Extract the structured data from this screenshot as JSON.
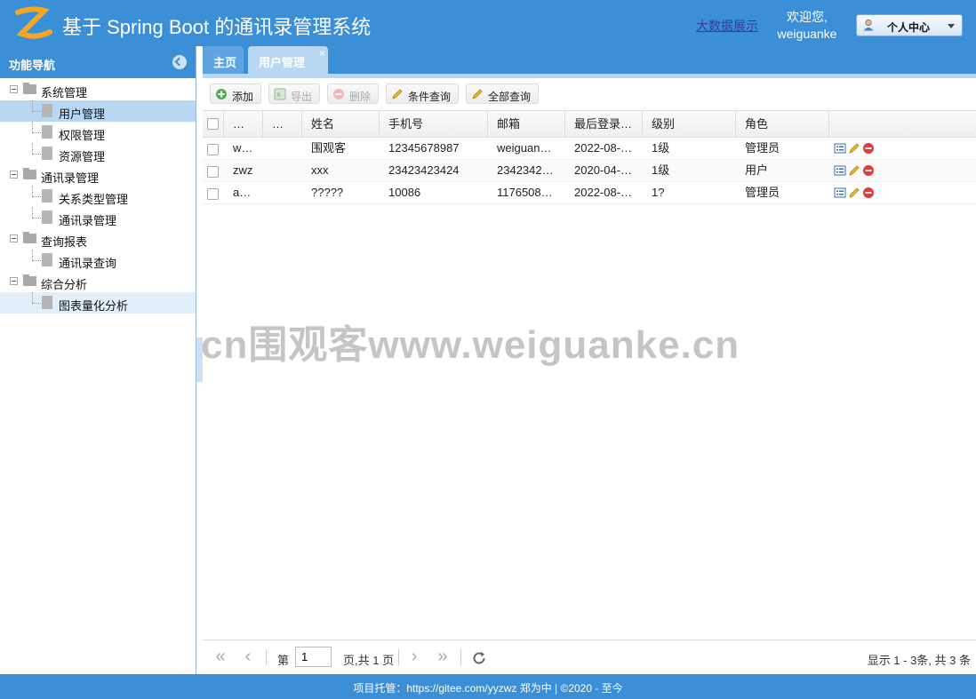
{
  "header": {
    "title": "基于 Spring Boot 的通讯录管理系统",
    "bigdata_link": "大数据展示",
    "welcome": "欢迎您,",
    "username": "weiguanke",
    "user_center": "个人中心"
  },
  "sidebar": {
    "title": "功能导航",
    "tree": [
      {
        "label": "系统管理",
        "children": [
          "用户管理",
          "权限管理",
          "资源管理"
        ]
      },
      {
        "label": "通讯录管理",
        "children": [
          "关系类型管理",
          "通讯录管理"
        ]
      },
      {
        "label": "查询报表",
        "children": [
          "通讯录查询"
        ]
      },
      {
        "label": "综合分析",
        "children": [
          "图表量化分析"
        ]
      }
    ]
  },
  "tabs": [
    {
      "label": "主页"
    },
    {
      "label": "用户管理",
      "close": "×"
    }
  ],
  "toolbar": {
    "add": "添加",
    "export": "导出",
    "delete": "删除",
    "cond_query": "条件查询",
    "all_query": "全部查询"
  },
  "grid": {
    "columns": [
      "…",
      "…",
      "姓名",
      "手机号",
      "邮箱",
      "最后登录…",
      "级别",
      "角色"
    ],
    "rows": [
      [
        "w…",
        "",
        "围观客",
        "12345678987",
        "weiguan…",
        "2022-08-…",
        "1级",
        "管理员"
      ],
      [
        "zwz",
        "",
        "xxx",
        "23423423424",
        "2342342…",
        "2020-04-…",
        "1级",
        "用户"
      ],
      [
        "a…",
        "",
        "?????",
        "10086",
        "1176508…",
        "2022-08-…",
        "1?",
        "管理员"
      ]
    ]
  },
  "pager": {
    "page_prefix": "第",
    "page_value": "1",
    "page_suffix": "页,共 1 页",
    "info": "显示 1 - 3条, 共 3 条"
  },
  "footer": {
    "text": "项目托管：https://gitee.com/yyzwz 郑为中 |   ©2020 - 至今"
  },
  "watermark": "cn围观客www.weiguanke.cn",
  "colors": {
    "primary": "#3a8fd6",
    "selected": "#b8d7f3",
    "logo": "#f5a623"
  }
}
